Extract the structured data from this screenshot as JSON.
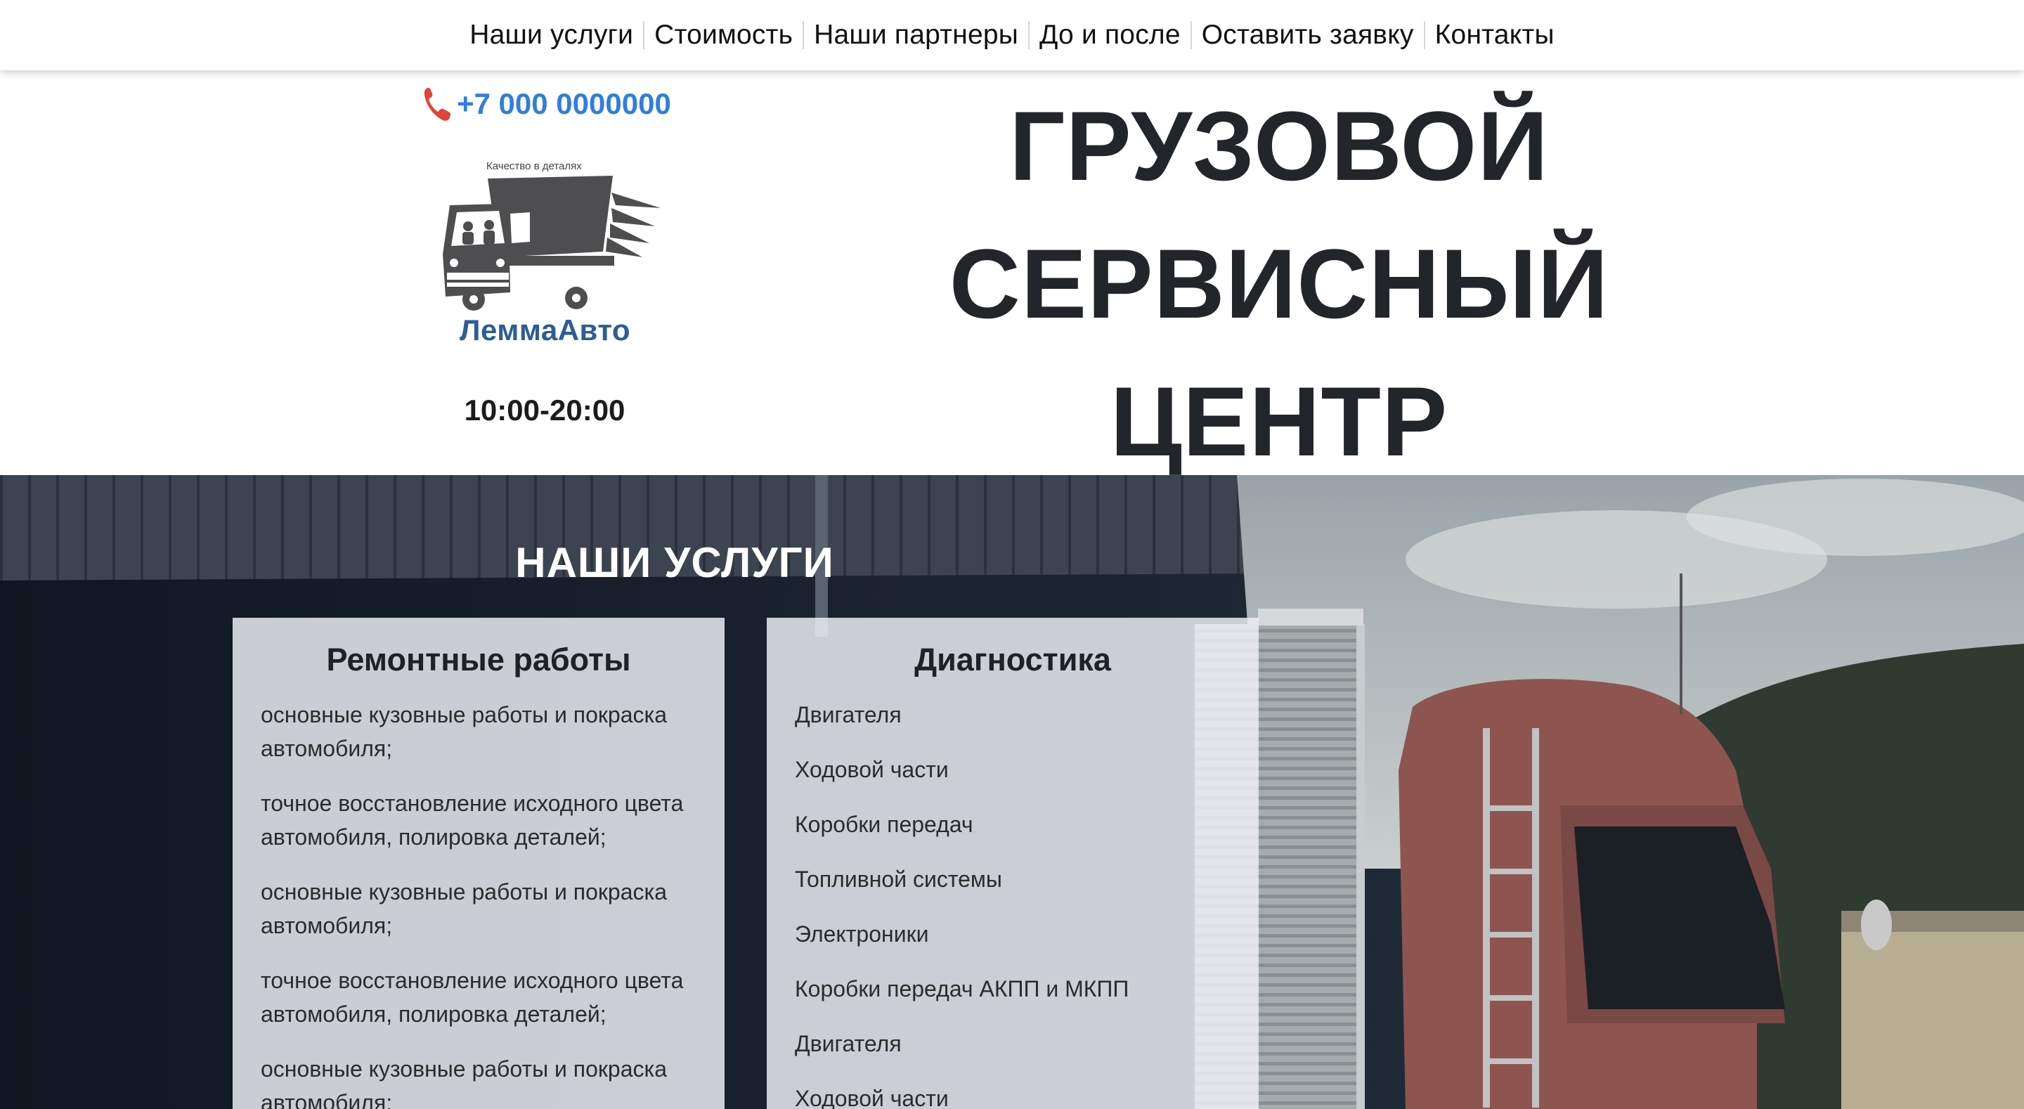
{
  "nav": {
    "items": [
      {
        "label": "Наши услуги"
      },
      {
        "label": "Стоимость"
      },
      {
        "label": "Наши партнеры"
      },
      {
        "label": "До и после"
      },
      {
        "label": "Оставить заявку"
      },
      {
        "label": "Контакты"
      }
    ]
  },
  "header": {
    "phone": "+7 000 0000000",
    "logo_tagline": "Качество в деталях",
    "logo_name": "ЛеммаАвто",
    "hours": "10:00-20:00",
    "title_lines": [
      "ГРУЗОВОЙ",
      "СЕРВИСНЫЙ",
      "ЦЕНТР"
    ]
  },
  "services": {
    "title": "НАШИ УСЛУГИ",
    "cards": [
      {
        "title": "Ремонтные работы",
        "items": [
          "основные кузовные работы и покраска автомобиля;",
          "точное восстановление исходного цвета автомобиля, полировка деталей;",
          "основные кузовные работы и покраска автомобиля;",
          "точное восстановление исходного цвета автомобиля, полировка деталей;",
          "основные кузовные работы и покраска автомобиля;"
        ]
      },
      {
        "title": "Диагностика",
        "items": [
          "Двигателя",
          "Ходовой части",
          "Коробки передач",
          "Топливной системы",
          "Электроники",
          "Коробки передач АКПП и МКПП",
          "Двигателя",
          "Ходовой части"
        ]
      }
    ]
  },
  "colors": {
    "accent_phone": "#2f7de1",
    "phone_icon": "#e0443a",
    "logo_blue": "#2d5d96",
    "heading_dark": "#22262b"
  },
  "icons": {
    "phone": "phone-icon",
    "logo": "truck-logo-icon"
  }
}
